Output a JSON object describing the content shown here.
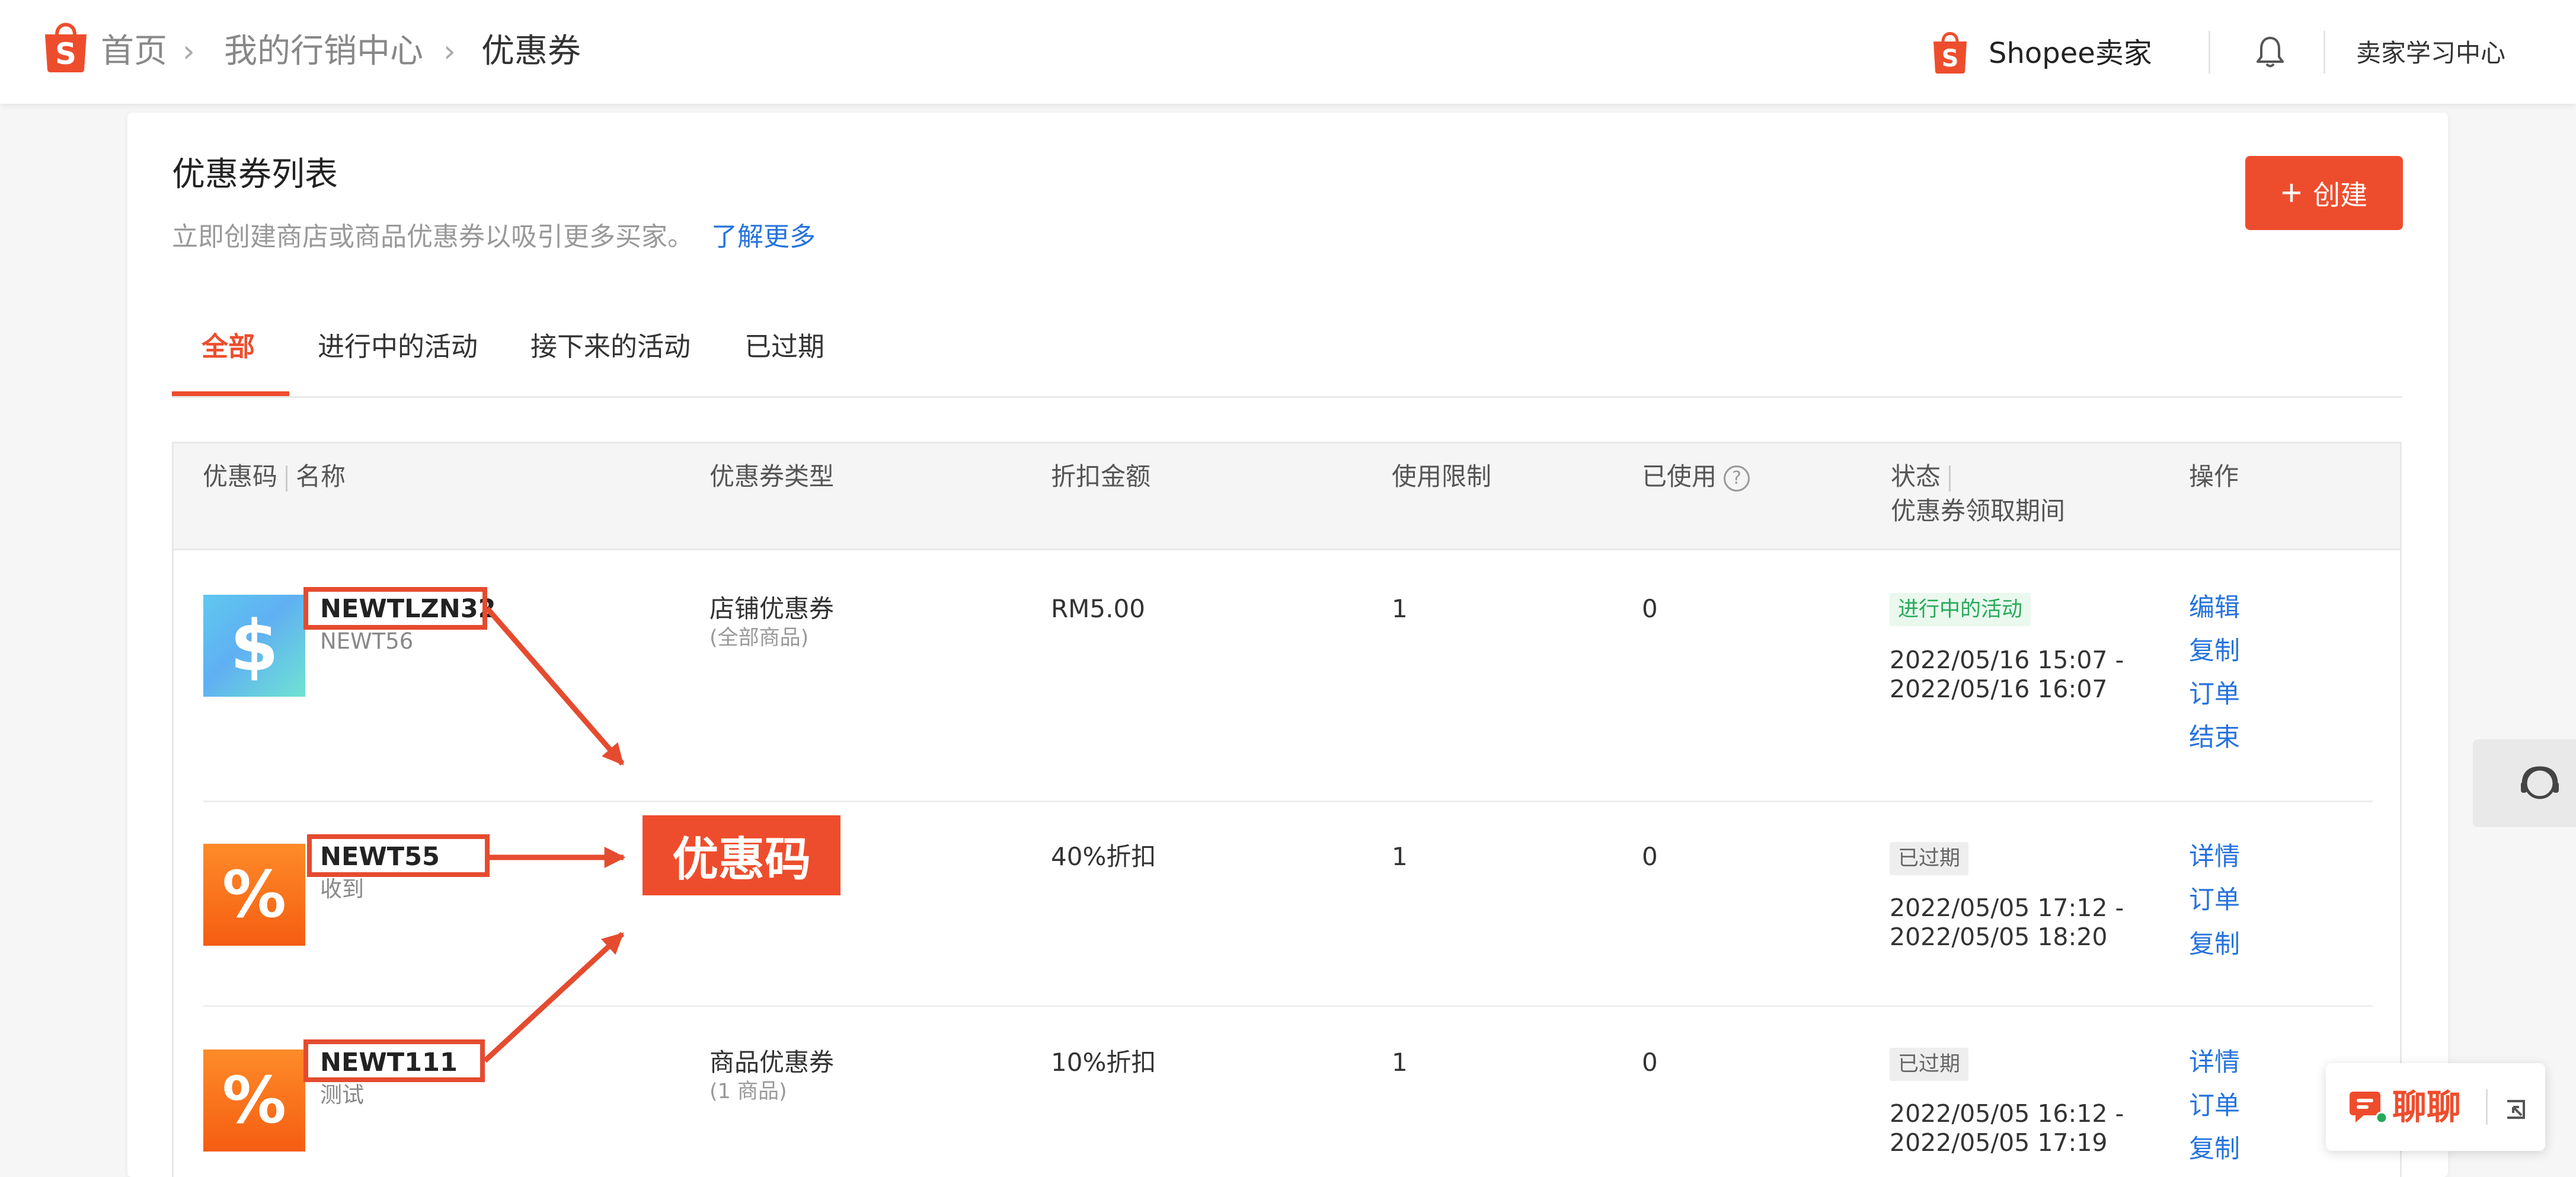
{
  "breadcrumb": {
    "home": "首页",
    "marketing": "我的行销中心",
    "current": "优惠券",
    "separator": "›"
  },
  "header": {
    "shop_name": "Shopee卖家",
    "learning_center": "卖家学习中心",
    "icons": [
      "shopee-bag-icon",
      "bell-icon"
    ]
  },
  "page": {
    "title": "优惠券列表",
    "subtitle": "立即创建商店或商品优惠券以吸引更多买家。",
    "learn_more": "了解更多",
    "create_plus": "+",
    "create_label": "创建"
  },
  "tabs": [
    {
      "label": "全部",
      "active": true
    },
    {
      "label": "进行中的活动",
      "active": false
    },
    {
      "label": "接下来的活动",
      "active": false
    },
    {
      "label": "已过期",
      "active": false
    }
  ],
  "table": {
    "headers": {
      "code": "优惠码",
      "name": "名称",
      "type": "优惠券类型",
      "discount": "折扣金额",
      "limit": "使用限制",
      "used": "已使用",
      "used_help": "?",
      "status": "状态",
      "period": "优惠券领取期间",
      "actions": "操作"
    },
    "rows": [
      {
        "thumb": "$",
        "code": "NEWTLZN32",
        "name": "NEWT56",
        "type": "店铺优惠券",
        "type_sub": "(全部商品)",
        "discount": "RM5.00",
        "limit": "1",
        "used": "0",
        "status": "进行中的活动",
        "period_start": "2022/05/16 15:07 -",
        "period_end": "2022/05/16 16:07",
        "actions": [
          "编辑",
          "复制",
          "订单",
          "结束"
        ]
      },
      {
        "thumb": "%",
        "code": "NEWT55",
        "name": "收到",
        "discount": "40%折扣",
        "limit": "1",
        "used": "0",
        "status": "已过期",
        "period_start": "2022/05/05 17:12 -",
        "period_end": "2022/05/05 18:20",
        "actions": [
          "详情",
          "订单",
          "复制"
        ]
      },
      {
        "thumb": "%",
        "code": "NEWT111",
        "name": "测试",
        "type": "商品优惠券",
        "type_sub": "(1 商品)",
        "discount": "10%折扣",
        "limit": "1",
        "used": "0",
        "status": "已过期",
        "period_start": "2022/05/05 16:12 -",
        "period_end": "2022/05/05 17:19",
        "actions": [
          "详情",
          "订单",
          "复制"
        ]
      }
    ]
  },
  "annotation": {
    "label": "优惠码",
    "color": "#e54b2f"
  },
  "chat": {
    "label": "聊聊"
  },
  "colors": {
    "brand": "#ee4d2d",
    "link": "#2673dd",
    "ongoing": "#26aa5a"
  }
}
